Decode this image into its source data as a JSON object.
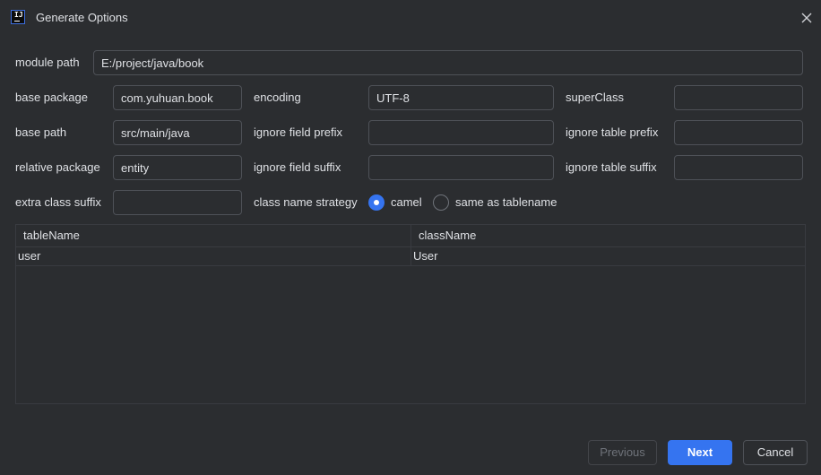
{
  "window": {
    "title": "Generate Options",
    "icon": "intellij-logo-icon",
    "icon_text": "IJ"
  },
  "form": {
    "module_path": {
      "label": "module path",
      "value": "E:/project/java/book"
    },
    "base_package": {
      "label": "base package",
      "value": "com.yuhuan.book"
    },
    "encoding": {
      "label": "encoding",
      "value": "UTF-8"
    },
    "super_class": {
      "label": "superClass",
      "value": ""
    },
    "base_path": {
      "label": "base path",
      "value": "src/main/java"
    },
    "ignore_field_prefix": {
      "label": "ignore field prefix",
      "value": ""
    },
    "ignore_table_prefix": {
      "label": "ignore table prefix",
      "value": ""
    },
    "relative_package": {
      "label": "relative package",
      "value": "entity"
    },
    "ignore_field_suffix": {
      "label": "ignore field suffix",
      "value": ""
    },
    "ignore_table_suffix": {
      "label": "ignore table suffix",
      "value": ""
    },
    "extra_class_suffix": {
      "label": "extra class suffix",
      "value": ""
    },
    "class_name_strategy": {
      "label": "class name strategy",
      "options": [
        "camel",
        "same as tablename"
      ],
      "selected": "camel"
    }
  },
  "table": {
    "columns": [
      "tableName",
      "className"
    ],
    "rows": [
      [
        "user",
        "User"
      ]
    ]
  },
  "buttons": {
    "previous": "Previous",
    "next": "Next",
    "cancel": "Cancel"
  },
  "colors": {
    "background": "#2b2d30",
    "accent": "#3574f0",
    "text": "#dfe1e5",
    "border": "#4e5157"
  }
}
